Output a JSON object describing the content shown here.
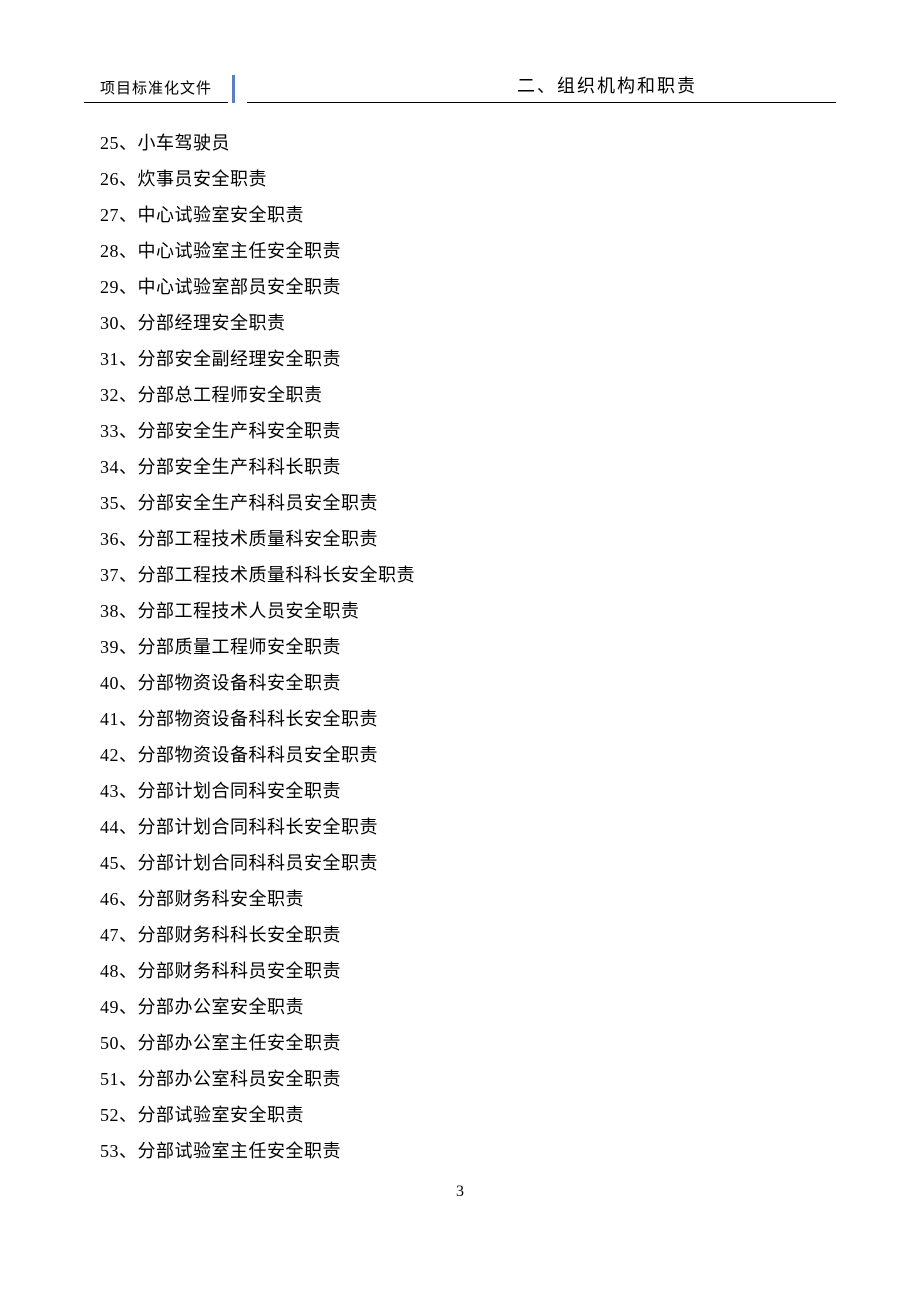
{
  "header": {
    "left": "项目标准化文件",
    "right": "二、组织机构和职责"
  },
  "toc_items": [
    {
      "num": "25",
      "text": "小车驾驶员"
    },
    {
      "num": "26",
      "text": "炊事员安全职责"
    },
    {
      "num": "27",
      "text": "中心试验室安全职责"
    },
    {
      "num": "28",
      "text": "中心试验室主任安全职责"
    },
    {
      "num": "29",
      "text": "中心试验室部员安全职责"
    },
    {
      "num": "30",
      "text": "分部经理安全职责"
    },
    {
      "num": "31",
      "text": "分部安全副经理安全职责"
    },
    {
      "num": "32",
      "text": "分部总工程师安全职责"
    },
    {
      "num": "33",
      "text": "分部安全生产科安全职责"
    },
    {
      "num": "34",
      "text": "分部安全生产科科长职责"
    },
    {
      "num": "35",
      "text": "分部安全生产科科员安全职责"
    },
    {
      "num": "36",
      "text": "分部工程技术质量科安全职责"
    },
    {
      "num": "37",
      "text": "分部工程技术质量科科长安全职责"
    },
    {
      "num": "38",
      "text": "分部工程技术人员安全职责"
    },
    {
      "num": "39",
      "text": "分部质量工程师安全职责"
    },
    {
      "num": "40",
      "text": "分部物资设备科安全职责"
    },
    {
      "num": "41",
      "text": "分部物资设备科科长安全职责"
    },
    {
      "num": "42",
      "text": "分部物资设备科科员安全职责"
    },
    {
      "num": "43",
      "text": "分部计划合同科安全职责"
    },
    {
      "num": "44",
      "text": "分部计划合同科科长安全职责"
    },
    {
      "num": "45",
      "text": "分部计划合同科科员安全职责"
    },
    {
      "num": "46",
      "text": "分部财务科安全职责"
    },
    {
      "num": "47",
      "text": "分部财务科科长安全职责"
    },
    {
      "num": "48",
      "text": "分部财务科科员安全职责"
    },
    {
      "num": "49",
      "text": "分部办公室安全职责"
    },
    {
      "num": "50",
      "text": "分部办公室主任安全职责"
    },
    {
      "num": "51",
      "text": "分部办公室科员安全职责"
    },
    {
      "num": "52",
      "text": "分部试验室安全职责"
    },
    {
      "num": "53",
      "text": "分部试验室主任安全职责"
    }
  ],
  "page_number": "3"
}
